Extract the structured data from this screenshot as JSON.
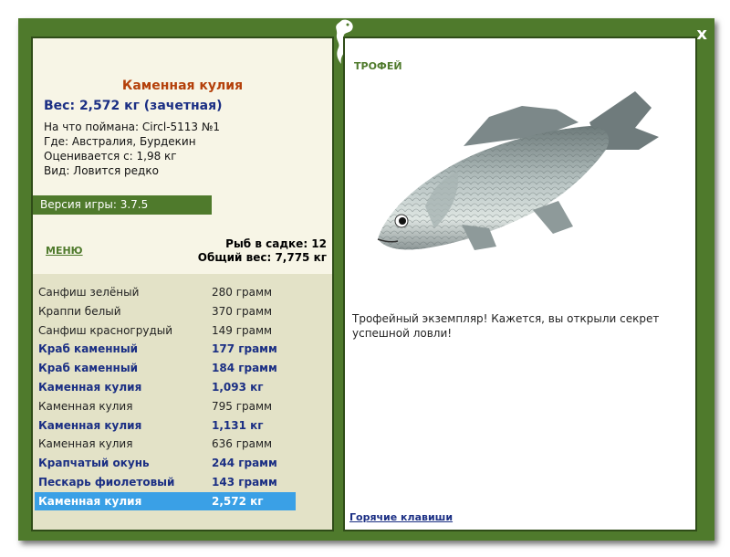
{
  "window": {
    "close_label": "x"
  },
  "catch": {
    "name": "Каменная кулия",
    "weight": "Вес: 2,572 кг (зачетная)",
    "caught_on": "На что поймана: Circl-5113 №1",
    "where": "Где: Австралия, Бурдекин",
    "valued_from": "Оценивается с: 1,98 кг",
    "kind": "Вид: Ловится редко"
  },
  "version_label": "Версия игры: 3.7.5",
  "menu_label": "МЕНЮ",
  "net": {
    "fish_count": "Рыб в садке: 12",
    "total_weight": "Общий вес: 7,775 кг"
  },
  "fish_list": [
    {
      "name": "Санфиш зелёный",
      "weight": "280 грамм",
      "style": "normal"
    },
    {
      "name": "Краппи белый",
      "weight": "370 грамм",
      "style": "normal"
    },
    {
      "name": "Санфиш красногрудый",
      "weight": "149 грамм",
      "style": "normal"
    },
    {
      "name": "Краб каменный",
      "weight": "177 грамм",
      "style": "bold"
    },
    {
      "name": "Краб каменный",
      "weight": "184 грамм",
      "style": "bold"
    },
    {
      "name": "Каменная кулия",
      "weight": "1,093 кг",
      "style": "bold"
    },
    {
      "name": "Каменная кулия",
      "weight": "795 грамм",
      "style": "normal"
    },
    {
      "name": "Каменная кулия",
      "weight": "1,131 кг",
      "style": "bold"
    },
    {
      "name": "Каменная кулия",
      "weight": "636 грамм",
      "style": "normal"
    },
    {
      "name": "Крапчатый окунь",
      "weight": "244 грамм",
      "style": "bold"
    },
    {
      "name": "Пескарь фиолетовый",
      "weight": "143 грамм",
      "style": "bold"
    },
    {
      "name": "Каменная кулия",
      "weight": "2,572 кг",
      "style": "selected"
    }
  ],
  "trophy": {
    "title": "ТРОФЕЙ",
    "text": "Трофейный экземпляр! Кажется, вы открыли секрет успешной ловли!",
    "image": "fish-illustration"
  },
  "hotkeys_label": "Горячие клавиши",
  "colors": {
    "frame": "#4f7a2c",
    "panel": "#f7f5e6",
    "list_bg": "#e3e2c7",
    "title_orange": "#b4400a",
    "text_blue": "#1b2f84",
    "selected": "#3aa0e6"
  }
}
